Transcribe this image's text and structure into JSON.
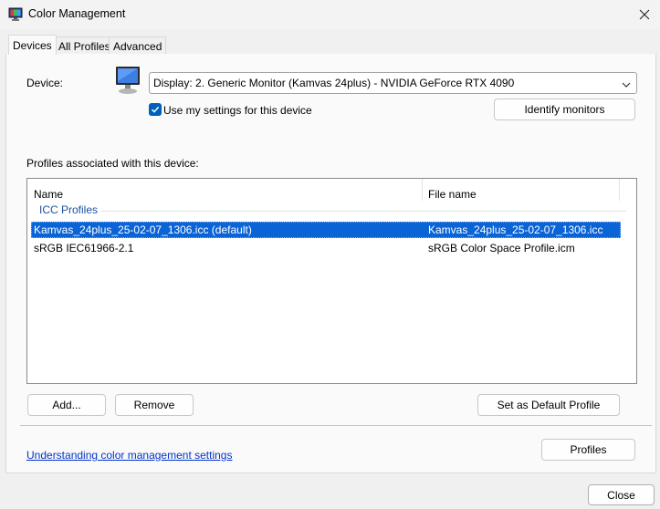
{
  "window": {
    "title": "Color Management"
  },
  "tabs": [
    {
      "label": "Devices",
      "active": true
    },
    {
      "label": "All Profiles",
      "active": false
    },
    {
      "label": "Advanced",
      "active": false
    }
  ],
  "device": {
    "label": "Device:",
    "selected": "Display: 2. Generic Monitor (Kamvas 24plus) - NVIDIA GeForce RTX 4090",
    "use_my_settings_label": "Use my settings for this device",
    "use_my_settings_checked": true,
    "identify_button": "Identify monitors"
  },
  "profiles": {
    "heading": "Profiles associated with this device:",
    "columns": [
      "Name",
      "File name"
    ],
    "group": "ICC Profiles",
    "rows": [
      {
        "name": "Kamvas_24plus_25-02-07_1306.icc (default)",
        "file": "Kamvas_24plus_25-02-07_1306.icc",
        "selected": true
      },
      {
        "name": "sRGB IEC61966-2.1",
        "file": "sRGB Color Space Profile.icm",
        "selected": false
      }
    ]
  },
  "buttons": {
    "add": "Add...",
    "remove": "Remove",
    "set_default": "Set as Default Profile",
    "profiles": "Profiles",
    "close": "Close"
  },
  "link": {
    "text": "Understanding color management settings"
  },
  "colors": {
    "accent": "#005fb8",
    "selection": "#0a64d6",
    "link": "#0033cc"
  }
}
